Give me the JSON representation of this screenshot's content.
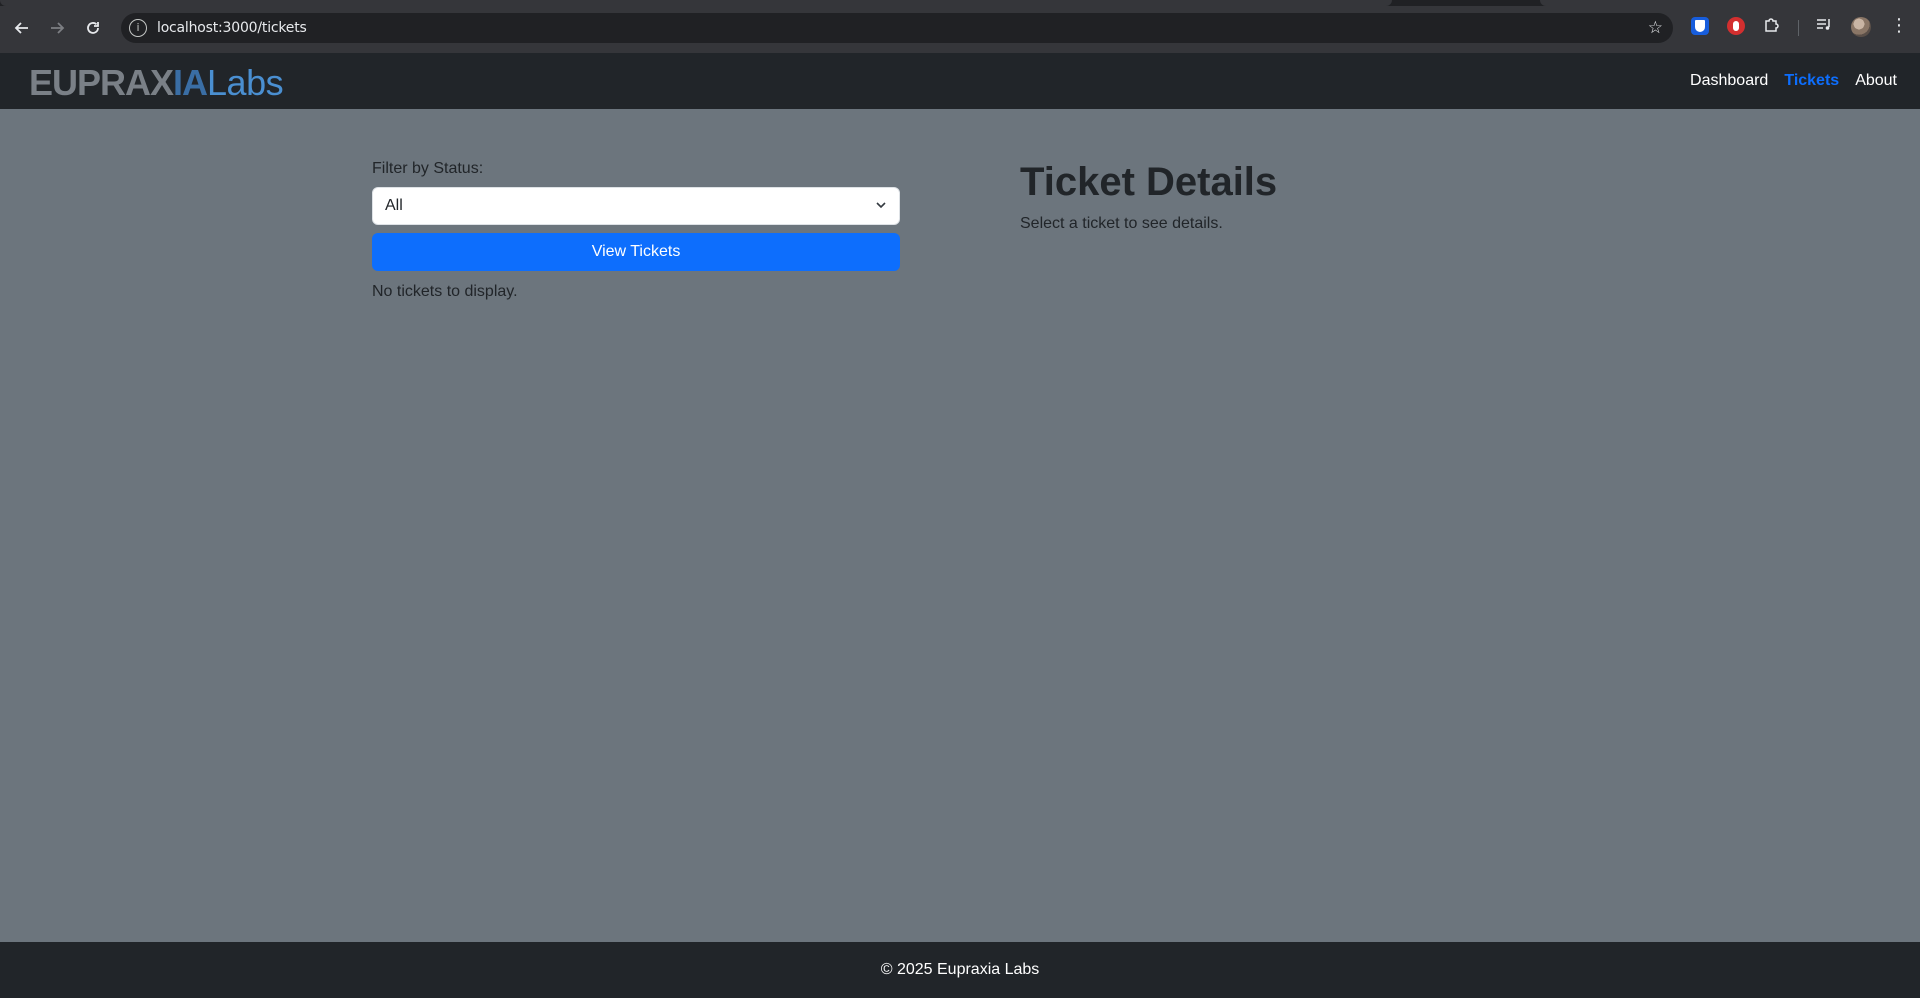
{
  "browser": {
    "url": "localhost:3000/tickets",
    "icons": [
      "back-arrow-icon",
      "forward-arrow-icon",
      "reload-icon",
      "site-info-icon",
      "bookmark-star-icon",
      "bitwarden-extension-icon",
      "hand-extension-icon",
      "extensions-puzzle-icon",
      "media-control-icon",
      "profile-avatar",
      "chrome-menu-icon"
    ]
  },
  "navbar": {
    "logo": {
      "bold_text": "EUPRAXIA",
      "light_text": "Labs"
    },
    "links": [
      {
        "label": "Dashboard",
        "active": false
      },
      {
        "label": "Tickets",
        "active": true
      },
      {
        "label": "About",
        "active": false
      }
    ],
    "active_color": "#0d6efd",
    "background": "#212529"
  },
  "filter": {
    "label": "Filter by Status:",
    "selected": "All"
  },
  "actions": {
    "view_tickets_label": "View Tickets"
  },
  "tickets": {
    "empty_message": "No tickets to display."
  },
  "details": {
    "heading": "Ticket Details",
    "placeholder": "Select a ticket to see details."
  },
  "footer": {
    "text": "© 2025 Eupraxia Labs"
  },
  "colors": {
    "page_background": "#6c757d",
    "primary_button": "#0d6efd"
  }
}
